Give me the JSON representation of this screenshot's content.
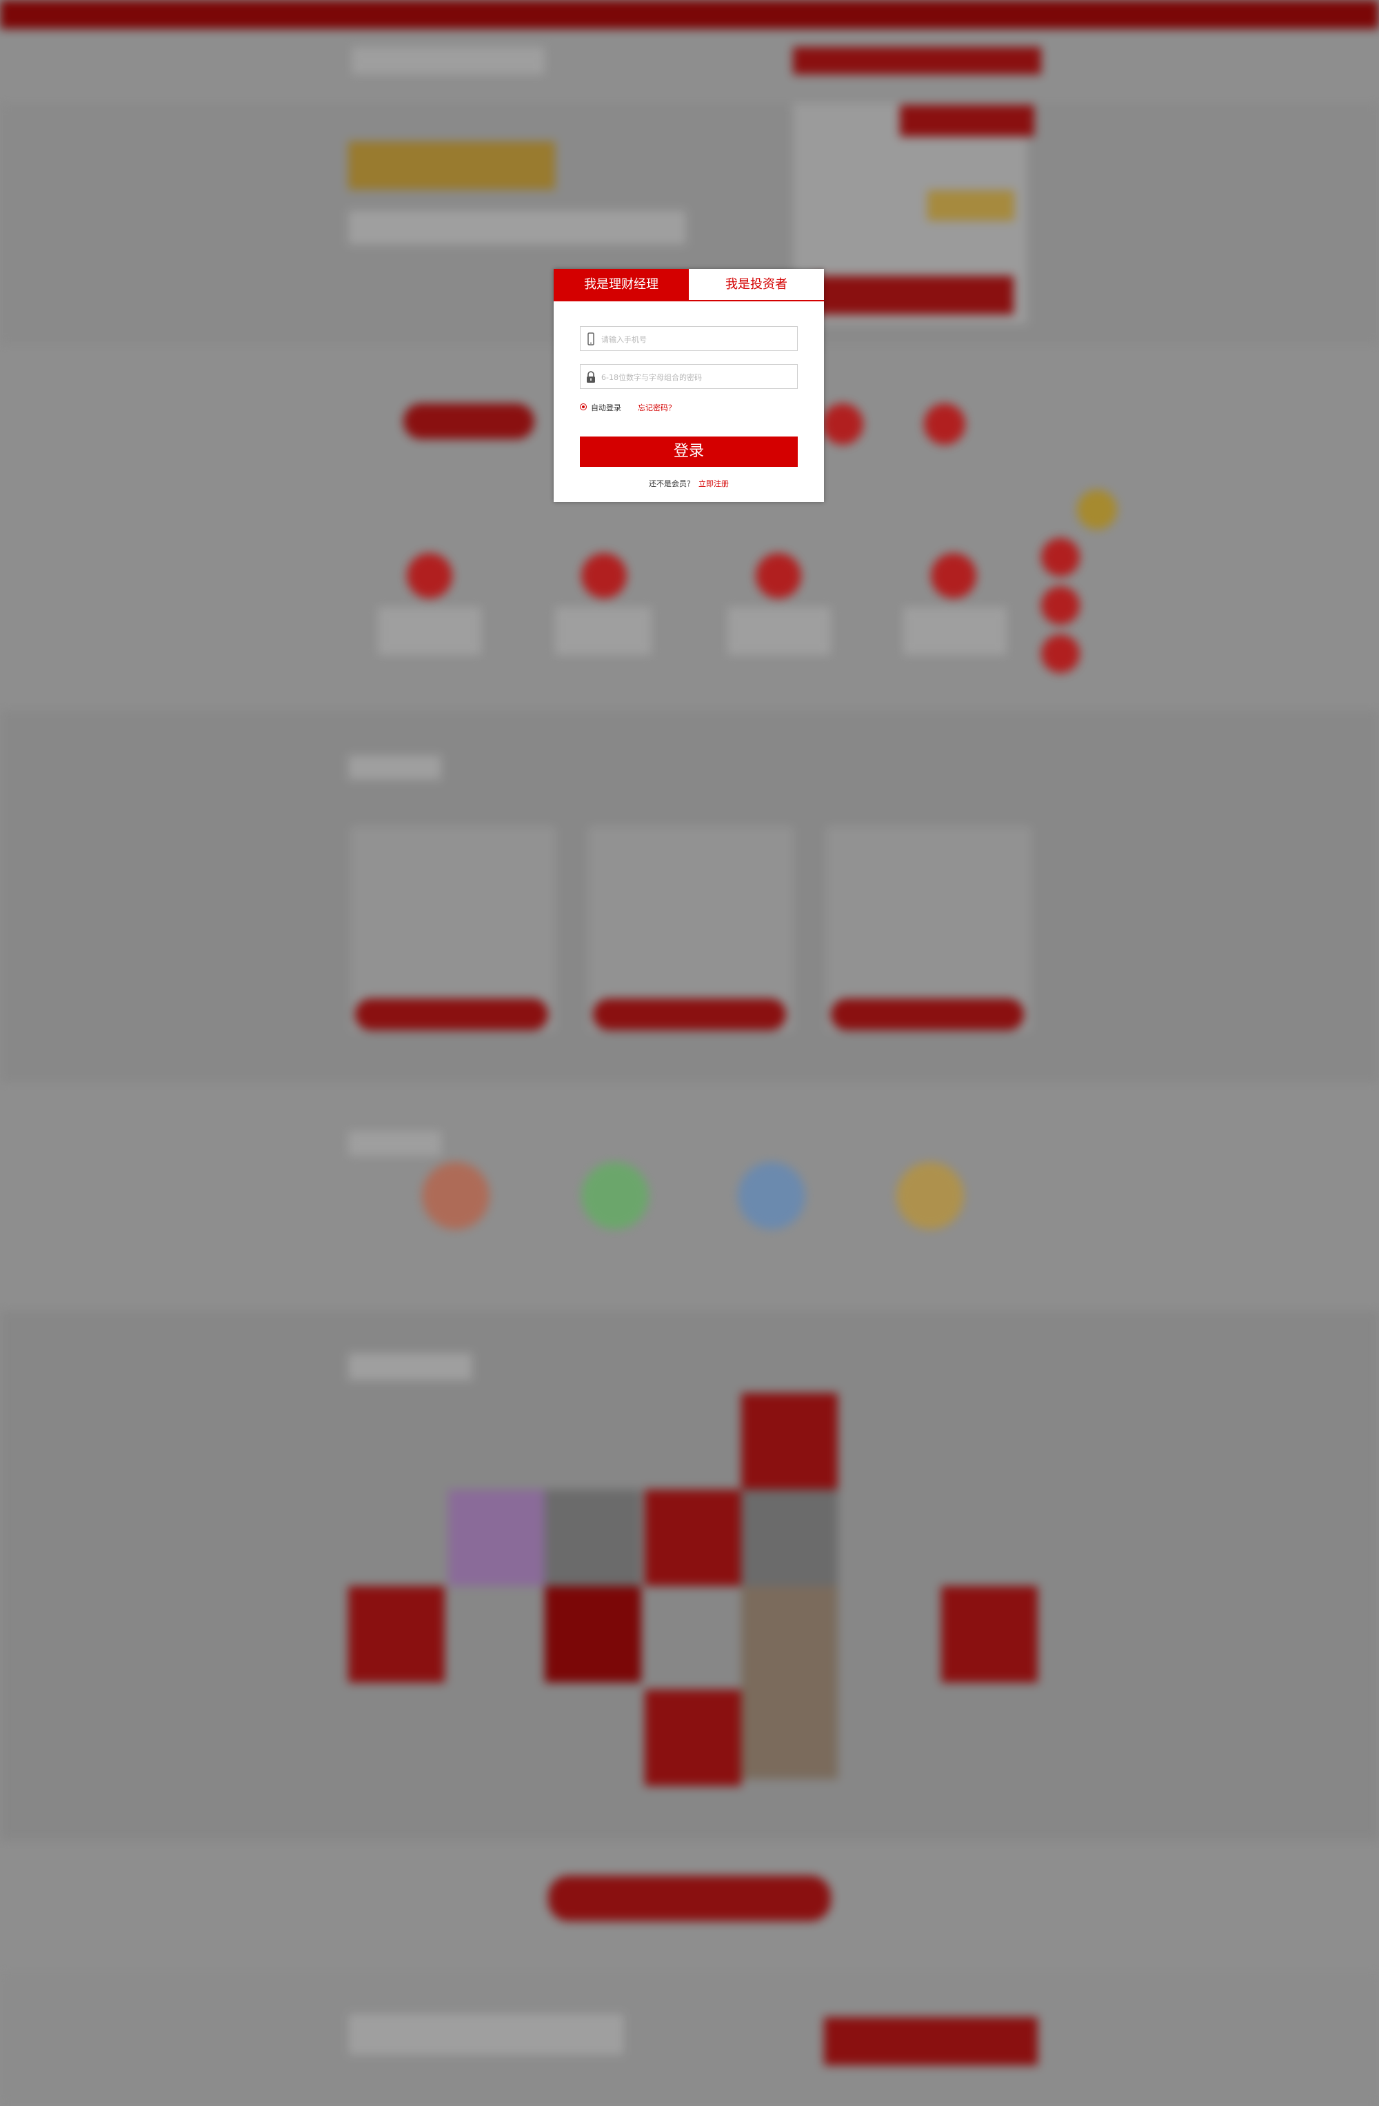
{
  "modal": {
    "tabs": [
      {
        "label": "我是理财经理",
        "active": true
      },
      {
        "label": "我是投资者",
        "active": false
      }
    ],
    "phone_placeholder": "请输入手机号",
    "password_placeholder": "6-18位数字与字母组合的密码",
    "auto_login_label": "自动登录",
    "forgot_label": "忘记密码？",
    "login_label": "登录",
    "register_prompt": "还不是会员？",
    "register_link": "立即注册"
  },
  "colors": {
    "accent": "#d40000",
    "overlay": "#8e8e8e"
  },
  "icons": {
    "phone": "phone-icon",
    "lock": "lock-icon"
  }
}
